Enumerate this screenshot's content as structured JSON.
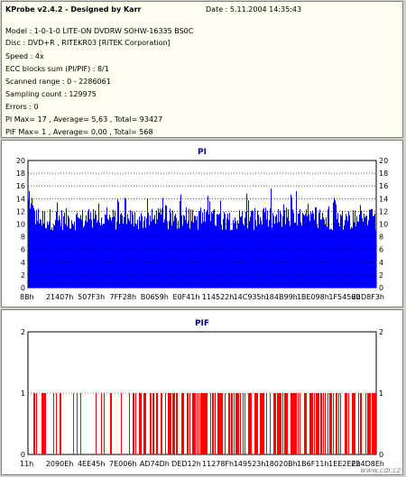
{
  "header": {
    "app_title": "KProbe v2.4.2 - Designed by Karr",
    "date": "Date : 5.11.2004 14:35:43"
  },
  "info": {
    "model": "Model : 1-0-1-0 LITE-ON DVDRW SOHW-16335 BS0C",
    "disc": "Disc : DVD+R , RITEKR03 [RiTEK Corporation]",
    "speed": "Speed : 4x",
    "ecc": "ECC blocks sum (PI/PIF) : 8/1",
    "range": "Scanned range : 0 - 2286061",
    "sampling": "Sampling count : 129975",
    "errors": "Errors : 0",
    "pi_stats": "PI Max= 17 , Average= 5,63 , Total= 93427",
    "pif_stats": "PIF Max= 1 , Average= 0,00 , Total= 568"
  },
  "colors": {
    "pi": "#0000ff",
    "pif": "#ff0000",
    "title": "#000080",
    "grid": "#000000"
  },
  "chart_data": [
    {
      "type": "bar",
      "title": "PI",
      "ylim": [
        0,
        20
      ],
      "yticks": [
        "0",
        "2",
        "4",
        "6",
        "8",
        "10",
        "12",
        "14",
        "16",
        "18",
        "20"
      ],
      "xticks": [
        "8Bh",
        "21407h",
        "507F3h",
        "7FF28h",
        "B0659h",
        "E0F41h",
        "114522h",
        "14C935h",
        "184B99h",
        "1BE098h",
        "1F5456h",
        "22D8F3h"
      ],
      "max": 17,
      "average": 5.63,
      "grid": true
    },
    {
      "type": "bar",
      "title": "PIF",
      "ylim": [
        0,
        2
      ],
      "yticks": [
        "0",
        "1",
        "2"
      ],
      "xticks": [
        "11h",
        "2090Eh",
        "4EE45h",
        "7E006h",
        "AD74Dh",
        "DED12h",
        "11278Fh",
        "149523h",
        "18020Bh",
        "1B6F11h",
        "1EE2EEh",
        "224D8Eh"
      ],
      "max": 1,
      "average": 0.0,
      "grid": true
    }
  ],
  "watermark": "www.cdr.cz"
}
